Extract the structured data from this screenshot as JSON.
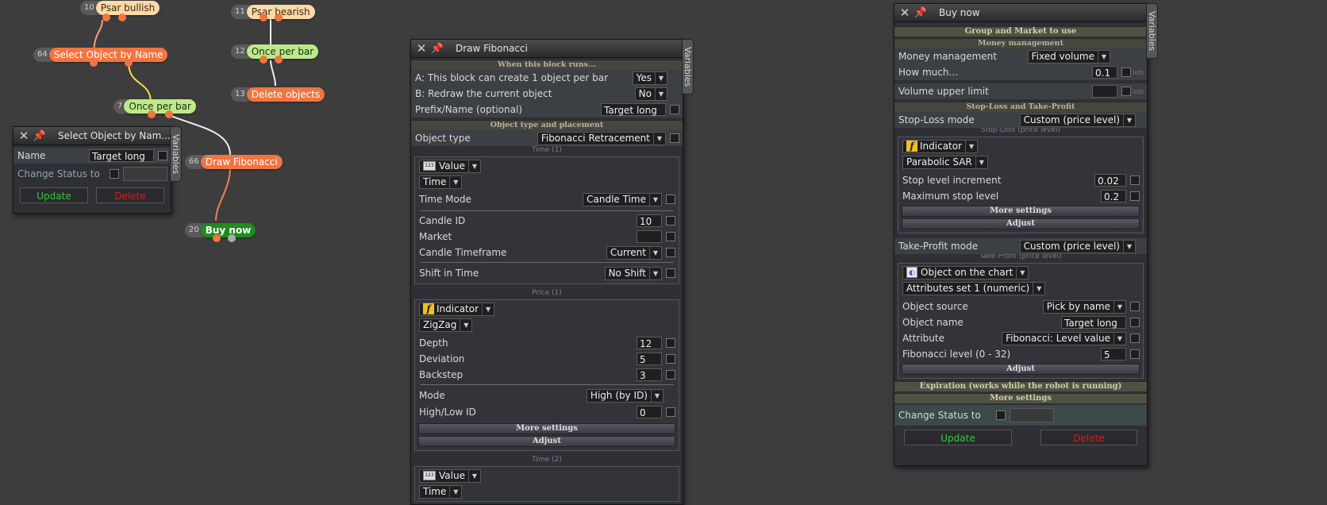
{
  "graph": {
    "nodes": [
      {
        "num": "10",
        "label": "Psar bullish",
        "style": "cream"
      },
      {
        "num": "11",
        "label": "Psar bearish",
        "style": "cream"
      },
      {
        "num": "64",
        "label": "Select Object by Name",
        "style": "orange"
      },
      {
        "num": "12",
        "label": "Once per bar",
        "style": "lime"
      },
      {
        "num": "13",
        "label": "Delete objects",
        "style": "orange"
      },
      {
        "num": "7",
        "label": "Once per bar",
        "style": "lime"
      },
      {
        "num": "66",
        "label": "Draw Fibonacci",
        "style": "orange"
      },
      {
        "num": "20",
        "label": "Buy now",
        "style": "green"
      }
    ]
  },
  "common": {
    "variables_tab": "Variables",
    "update": "Update",
    "delete": "Delete",
    "change_status": "Change Status to",
    "lots": "lots"
  },
  "select_window": {
    "title": "Select Object by Nam...",
    "name_label": "Name",
    "name_value": "Target long"
  },
  "fib_window": {
    "title": "Draw Fibonacci",
    "sec_when": "When this block runs...",
    "a_label": "A: This block can create 1 object per bar",
    "a_value": "Yes",
    "b_label": "B: Redraw the current object",
    "b_value": "No",
    "prefix_label": "Prefix/Name (optional)",
    "prefix_value": "Target long",
    "sec_type": "Object type and placement",
    "type_label": "Object type",
    "type_value": "Fibonacci Retracement",
    "time1": "Time (1)",
    "t1_kind": "Value",
    "t1_sub": "Time",
    "time_mode_label": "Time Mode",
    "time_mode_value": "Candle Time",
    "candle_id_label": "Candle ID",
    "candle_id_value": "10",
    "market_label": "Market",
    "market_value": "",
    "timeframe_label": "Candle Timeframe",
    "timeframe_value": "Current",
    "shift_label": "Shift in Time",
    "shift_value": "No Shift",
    "price1": "Price (1)",
    "p1_kind": "Indicator",
    "p1_ind": "ZigZag",
    "depth_label": "Depth",
    "depth_value": "12",
    "deviation_label": "Deviation",
    "deviation_value": "5",
    "backstep_label": "Backstep",
    "backstep_value": "3",
    "mode_label": "Mode",
    "mode_value": "High (by ID)",
    "hlid_label": "High/Low ID",
    "hlid_value": "0",
    "more_settings": "More settings",
    "adjust": "Adjust",
    "time2": "Time (2)",
    "t2_kind": "Value",
    "t2_sub": "Time"
  },
  "buy_window": {
    "title": "Buy now",
    "sec_group": "Group and Market to use",
    "sec_money": "Money management",
    "mm_label": "Money management",
    "mm_value": "Fixed volume",
    "how_label": "How much...",
    "how_value": "0.1",
    "vul_label": "Volume upper limit",
    "vul_value": "",
    "sec_sltp": "Stop-Loss and Take-Profit",
    "sl_mode_label": "Stop-Loss mode",
    "sl_mode_value": "Custom (price level)",
    "sl_price": "Stop-Loss (price level)",
    "sl_kind": "Indicator",
    "sl_ind": "Parabolic SAR",
    "step_label": "Stop level increment",
    "step_value": "0.02",
    "max_label": "Maximum stop level",
    "max_value": "0.2",
    "more_settings": "More settings",
    "adjust": "Adjust",
    "tp_mode_label": "Take-Profit mode",
    "tp_mode_value": "Custom (price level)",
    "tp_price": "Take-Profit (price level)",
    "tp_kind": "Object on the chart",
    "tp_attrset": "Attributes set 1 (numeric)",
    "src_label": "Object source",
    "src_value": "Pick by name",
    "oname_label": "Object name",
    "oname_value": "Target long",
    "attr_label": "Attribute",
    "attr_value": "Fibonacci: Level value",
    "fiblvl_label": "Fibonacci level (0 - 32)",
    "fiblvl_value": "5",
    "sec_expiration": "Expiration (works while the robot is running)",
    "sec_more": "More settings"
  }
}
